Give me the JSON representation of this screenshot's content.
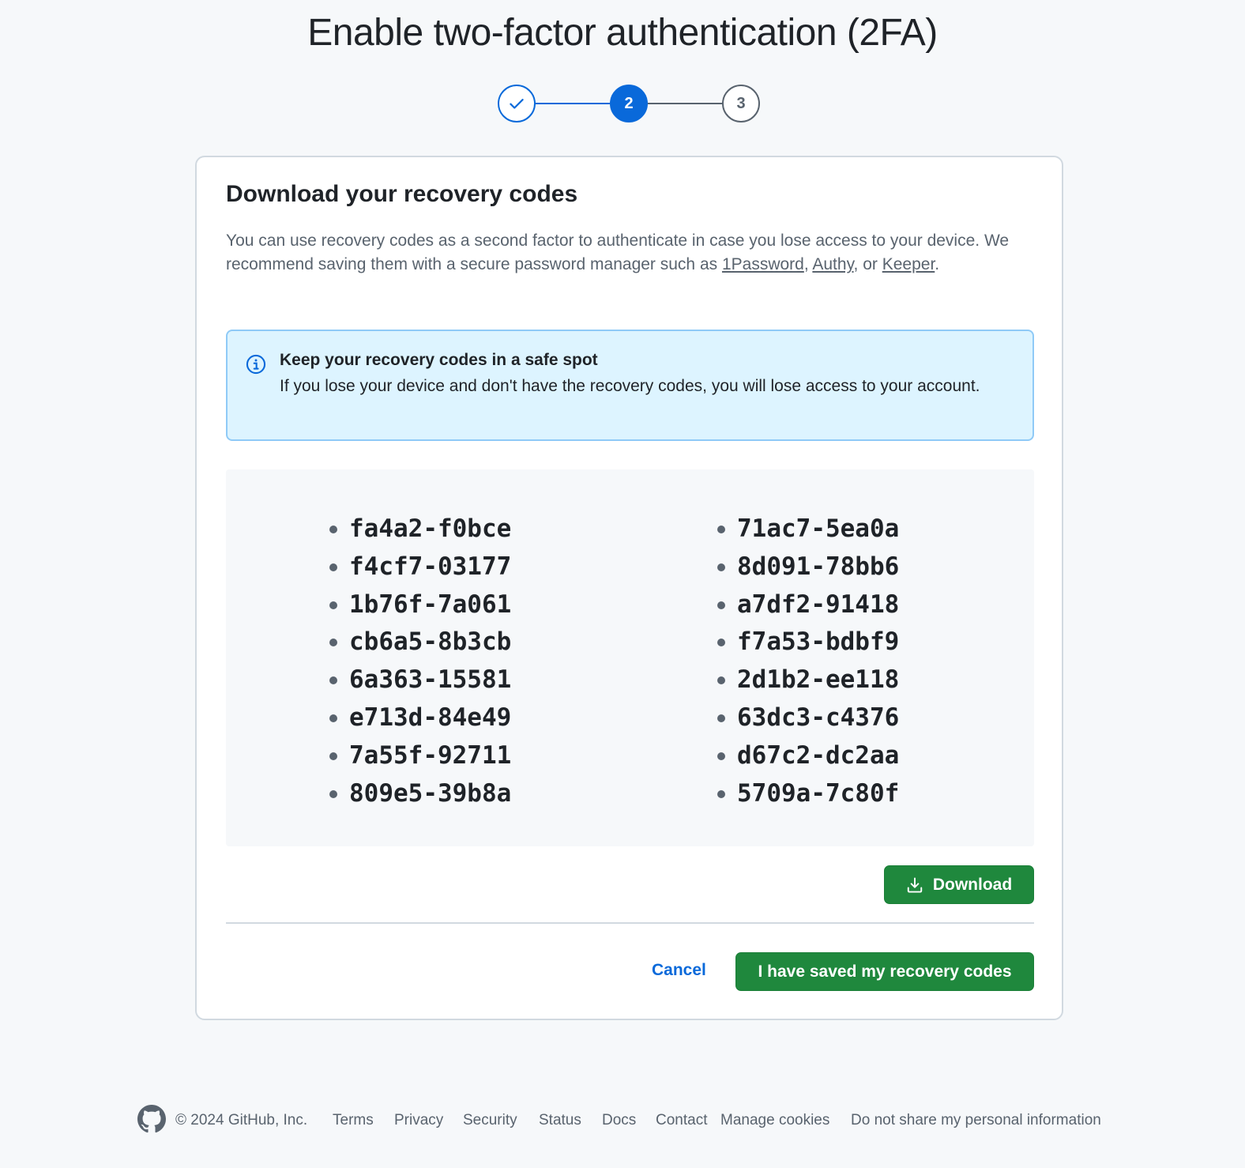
{
  "page": {
    "title": "Enable two-factor authentication (2FA)"
  },
  "stepper": {
    "steps": [
      {
        "label": "",
        "state": "complete",
        "icon": "check-icon"
      },
      {
        "label": "2",
        "state": "current"
      },
      {
        "label": "3",
        "state": "upcoming"
      }
    ],
    "accent_color": "#0969da"
  },
  "card": {
    "title": "Download your recovery codes",
    "desc_text_1": "You can use recovery codes as a second factor to authenticate in case you lose access to your device. We recommend saving them with a secure password manager such as ",
    "link_1password": "1Password",
    "sep_1": ", ",
    "link_authy": "Authy",
    "sep_2": ", or ",
    "link_keeper": "Keeper",
    "desc_end": "."
  },
  "flash": {
    "icon": "info-icon",
    "title": "Keep your recovery codes in a safe spot",
    "body": "If you lose your device and don't have the recovery codes, you will lose access to your account."
  },
  "codes": {
    "left": [
      "fa4a2-f0bce",
      "f4cf7-03177",
      "1b76f-7a061",
      "cb6a5-8b3cb",
      "6a363-15581",
      "e713d-84e49",
      "7a55f-92711",
      "809e5-39b8a"
    ],
    "right": [
      "71ac7-5ea0a",
      "8d091-78bb6",
      "a7df2-91418",
      "f7a53-bdbf9",
      "2d1b2-ee118",
      "63dc3-c4376",
      "d67c2-dc2aa",
      "5709a-7c80f"
    ]
  },
  "actions": {
    "download_label": "Download",
    "download_icon": "download-icon",
    "cancel_label": "Cancel",
    "saved_label": "I have saved my recovery codes",
    "primary_color": "#1f883d"
  },
  "footer": {
    "logo": "github-icon",
    "copyright": "© 2024 GitHub, Inc.",
    "links": [
      "Terms",
      "Privacy",
      "Security",
      "Status",
      "Docs",
      "Contact",
      "Manage cookies",
      "Do not share my personal information"
    ]
  }
}
